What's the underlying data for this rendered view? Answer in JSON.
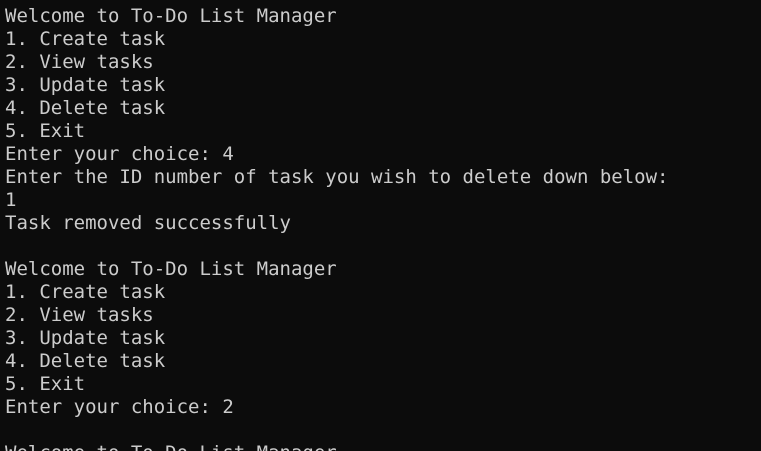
{
  "terminal": {
    "colors": {
      "background": "#0c0c0c",
      "foreground": "#cccccc"
    },
    "lines": [
      "Welcome to To-Do List Manager",
      "1. Create task",
      "2. View tasks",
      "3. Update task",
      "4. Delete task",
      "5. Exit",
      "Enter your choice: 4",
      "Enter the ID number of task you wish to delete down below:",
      "1",
      "Task removed successfully",
      "",
      "Welcome to To-Do List Manager",
      "1. Create task",
      "2. View tasks",
      "3. Update task",
      "4. Delete task",
      "5. Exit",
      "Enter your choice: 2",
      "",
      "Welcome to To-Do List Manager"
    ]
  }
}
